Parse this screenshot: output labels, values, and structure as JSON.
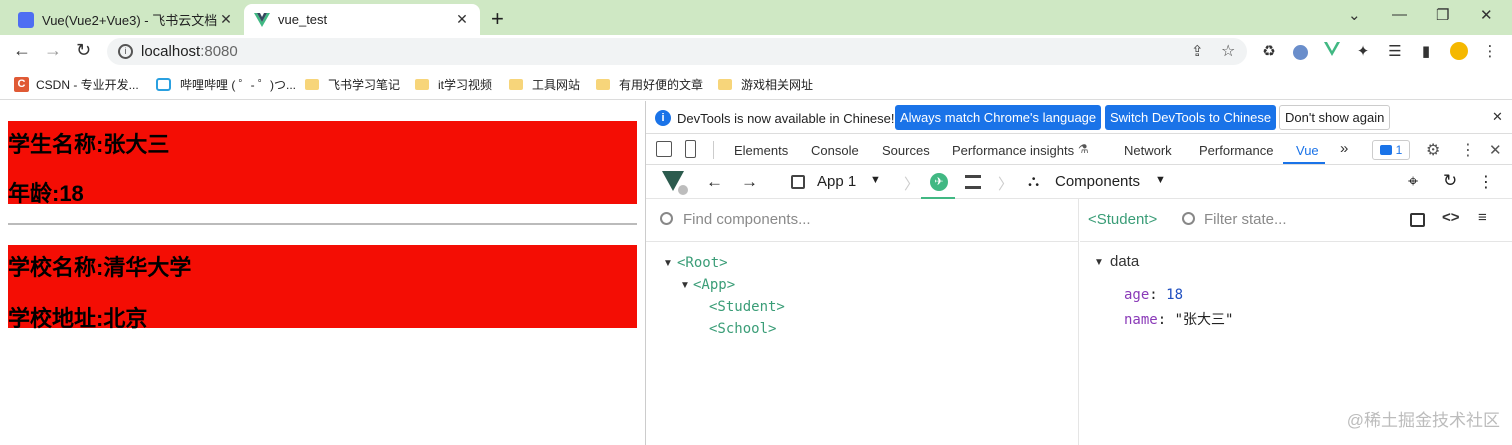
{
  "browser": {
    "tabs": [
      {
        "title": "Vue(Vue2+Vue3) - 飞书云文档",
        "close": "✕"
      },
      {
        "title": "vue_test",
        "close": "✕"
      }
    ],
    "new_tab": "+",
    "window_controls": {
      "minimize": "⌄",
      "restore": "—",
      "maximize": "❐",
      "close": "✕"
    },
    "url": {
      "host": "localhost",
      "port": ":8080"
    },
    "bookmarks": [
      {
        "label": "CSDN - 专业开发...",
        "icon": "csdn-icon"
      },
      {
        "label": "哔哩哔哩 ( ゜- ゜)つ...",
        "icon": "bilibili-icon"
      },
      {
        "label": "飞书学习笔记",
        "icon": "folder-icon"
      },
      {
        "label": "it学习视频",
        "icon": "folder-icon"
      },
      {
        "label": "工具网站",
        "icon": "folder-icon"
      },
      {
        "label": "有用好便的文章",
        "icon": "folder-icon"
      },
      {
        "label": "游戏相关网址",
        "icon": "folder-icon"
      }
    ],
    "csdn_letter": "C"
  },
  "page": {
    "student_name": "学生名称:张大三",
    "student_age": "年龄:18",
    "school_name": "学校名称:清华大学",
    "school_address": "学校地址:北京"
  },
  "devtools": {
    "info": {
      "message": "DevTools is now available in Chinese!",
      "btn_match": "Always match Chrome's language",
      "btn_switch": "Switch DevTools to Chinese",
      "btn_dismiss": "Don't show again"
    },
    "tabs": [
      "Elements",
      "Console",
      "Sources",
      "Performance insights",
      "Network",
      "Performance",
      "Vue"
    ],
    "more": "»",
    "issues_count": "1",
    "vue_toolbar": {
      "app": "App 1",
      "view": "Components"
    },
    "components": {
      "search_placeholder": "Find components...",
      "tree": [
        "<Root>",
        "<App>",
        "<Student>",
        "<School>"
      ]
    },
    "inspector": {
      "selected": "<Student>",
      "filter_placeholder": "Filter state...",
      "section": "data",
      "props": [
        {
          "key": "age",
          "value": "18"
        },
        {
          "key": "name",
          "value": "\"张大三\""
        }
      ]
    }
  },
  "watermark": "@稀土掘金技术社区",
  "colors": {
    "red_box": "#f40d04",
    "tab_bar": "#cfe8c4",
    "accent": "#1a73e8",
    "vue_green": "#3a9d77"
  }
}
